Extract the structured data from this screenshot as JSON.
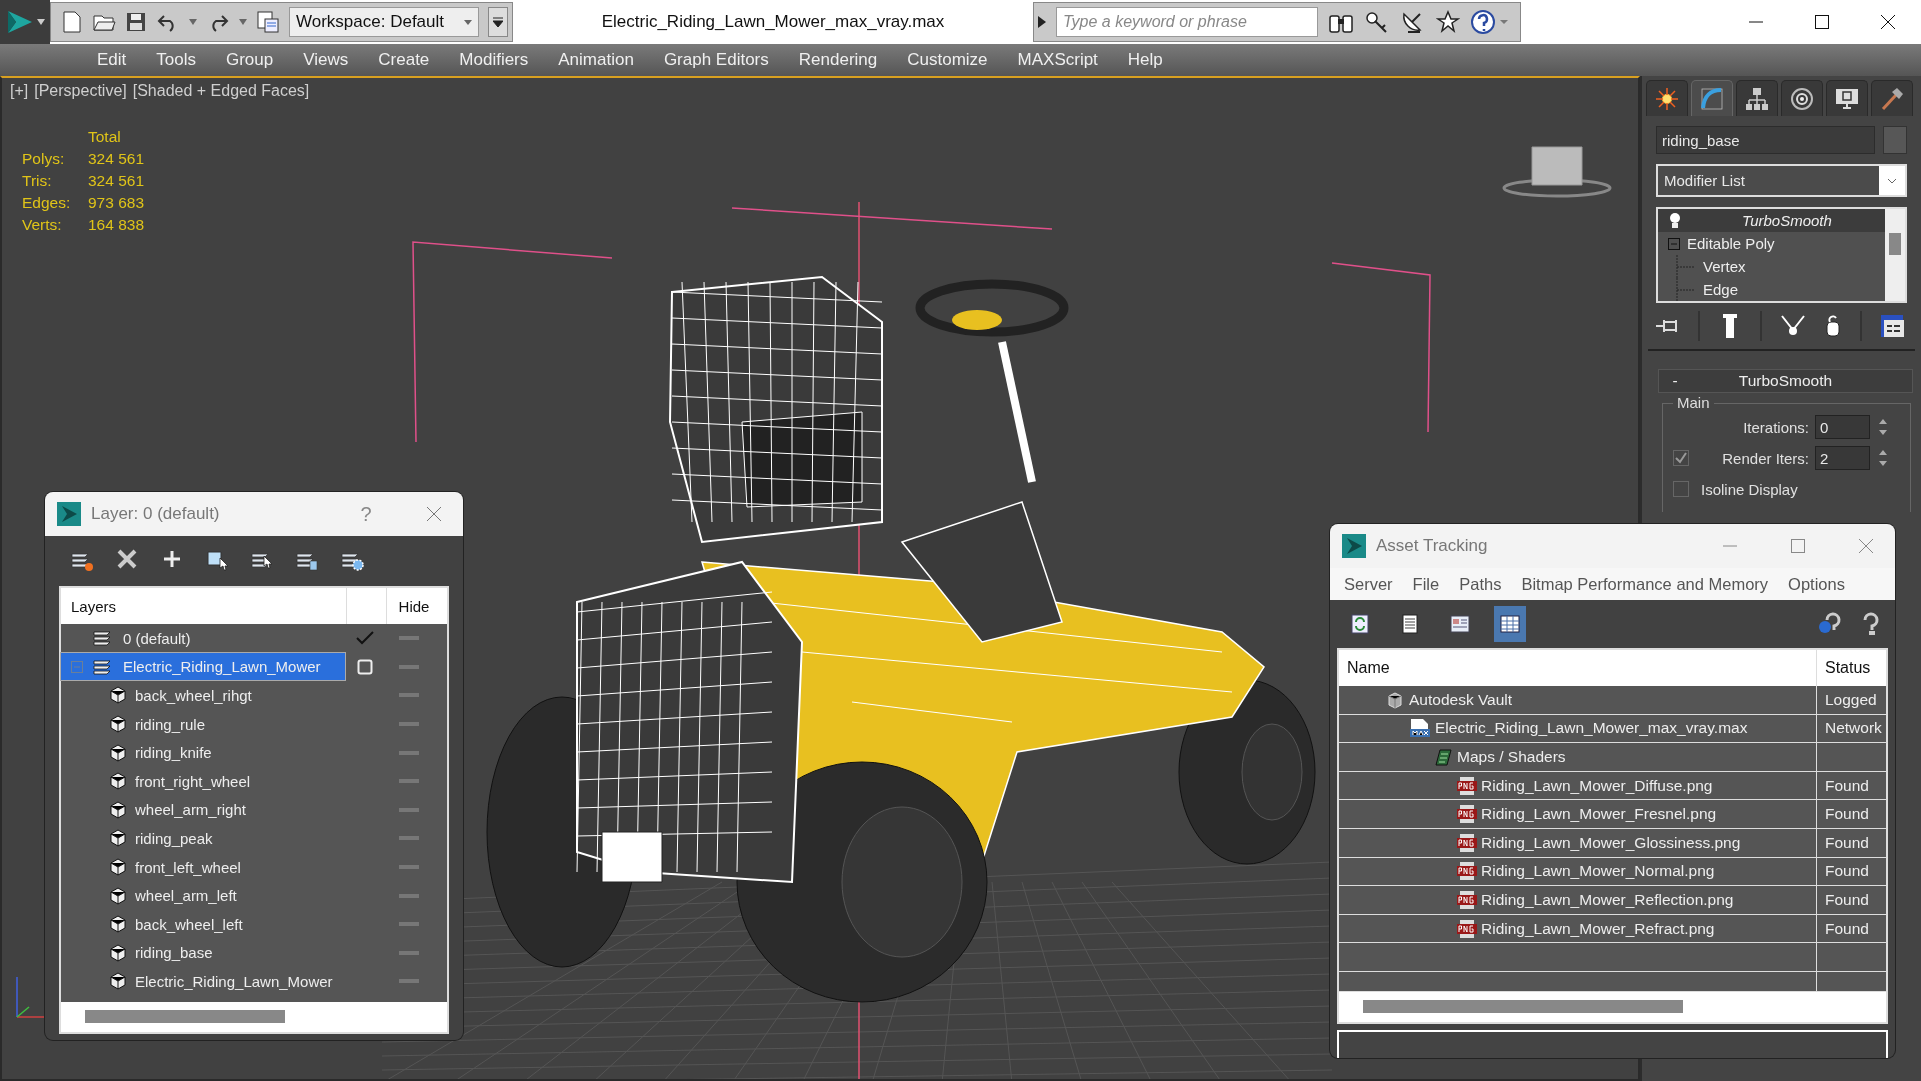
{
  "app_bar": {
    "workspace": "Workspace: Default",
    "title": "Electric_Riding_Lawn_Mower_max_vray.max",
    "search": {
      "placeholder": "Type a keyword or phrase"
    }
  },
  "menu": [
    "Edit",
    "Tools",
    "Group",
    "Views",
    "Create",
    "Modifiers",
    "Animation",
    "Graph Editors",
    "Rendering",
    "Customize",
    "MAXScript",
    "Help"
  ],
  "viewport": {
    "labels": [
      "[+]",
      "[Perspective]",
      "[Shaded + Edged Faces]"
    ],
    "stats_header": "Total",
    "stats": [
      {
        "label": "Polys:",
        "value": "324 561"
      },
      {
        "label": "Tris:",
        "value": "324 561"
      },
      {
        "label": "Edges:",
        "value": "973 683"
      },
      {
        "label": "Verts:",
        "value": "164 838"
      }
    ]
  },
  "command_panel": {
    "tabs": [
      {
        "kind": "create",
        "selected": false
      },
      {
        "kind": "modify",
        "selected": true
      },
      {
        "kind": "hierarchy",
        "selected": false
      },
      {
        "kind": "motion",
        "selected": false
      },
      {
        "kind": "display",
        "selected": false
      },
      {
        "kind": "utilities",
        "selected": false
      }
    ],
    "object_name": "riding_base",
    "modifier_list": "Modifier List",
    "stack": [
      {
        "label": "TurboSmooth",
        "kind": "modifier",
        "selected": true
      },
      {
        "label": "Editable Poly",
        "kind": "object",
        "selected": false,
        "expanded": true
      },
      {
        "label": "Vertex",
        "kind": "sub",
        "selected": false
      },
      {
        "label": "Edge",
        "kind": "sub",
        "selected": false
      }
    ],
    "rollout": {
      "title": "TurboSmooth",
      "collapse": "-",
      "group": "Main",
      "params": [
        {
          "kind": "spinner",
          "label": "Iterations:",
          "value": "0"
        },
        {
          "kind": "check-spinner",
          "label": "Render Iters:",
          "value": "2",
          "checked": true
        },
        {
          "kind": "checkbox",
          "label": "Isoline Display",
          "checked": false
        }
      ]
    }
  },
  "layer_dialog": {
    "title": "Layer: 0 (default)",
    "help": "?",
    "toolbar": [
      {
        "kind": "create"
      },
      {
        "kind": "delete"
      },
      {
        "kind": "add"
      },
      {
        "kind": "select-objects"
      },
      {
        "kind": "select-layer"
      },
      {
        "kind": "current"
      },
      {
        "kind": "options"
      }
    ],
    "columns": [
      "Layers",
      "Hide"
    ],
    "layers": [
      {
        "name": "0 (default)",
        "current": true,
        "selected": false
      },
      {
        "name": "Electric_Riding_Lawn_Mower",
        "current": false,
        "selected": true,
        "expanded": true,
        "children": [
          {
            "name": "back_wheel_rihgt",
            "selected": false
          },
          {
            "name": "riding_rule",
            "selected": false
          },
          {
            "name": "riding_knife",
            "selected": false
          },
          {
            "name": "front_right_wheel",
            "selected": false
          },
          {
            "name": "wheel_arm_right",
            "selected": false
          },
          {
            "name": "riding_peak",
            "selected": false
          },
          {
            "name": "front_left_wheel",
            "selected": false
          },
          {
            "name": "wheel_arm_left",
            "selected": false
          },
          {
            "name": "back_wheel_left",
            "selected": false
          },
          {
            "name": "riding_base",
            "selected": false
          },
          {
            "name": "Electric_Riding_Lawn_Mower",
            "selected": false
          }
        ]
      }
    ]
  },
  "asset_tracking": {
    "title": "Asset Tracking",
    "menu": [
      "Server",
      "File",
      "Paths",
      "Bitmap Performance and Memory",
      "Options"
    ],
    "toolbar": [
      {
        "kind": "refresh",
        "selected": false
      },
      {
        "kind": "list",
        "selected": false
      },
      {
        "kind": "thumbnails",
        "selected": false
      },
      {
        "kind": "table",
        "selected": true
      }
    ],
    "columns": [
      "Name",
      "Status"
    ],
    "rows": [
      {
        "name": "Autodesk Vault",
        "status": "Logged",
        "kind": "vault",
        "children": [
          {
            "name": "Electric_Riding_Lawn_Mower_max_vray.max",
            "status": "Network",
            "kind": "scene",
            "children": [
              {
                "name": "Maps / Shaders",
                "kind": "maps",
                "children": [
                  {
                    "name": "Riding_Lawn_Mower_Diffuse.png",
                    "status": "Found",
                    "kind": "png"
                  },
                  {
                    "name": "Riding_Lawn_Mower_Fresnel.png",
                    "status": "Found",
                    "kind": "png"
                  },
                  {
                    "name": "Riding_Lawn_Mower_Glossiness.png",
                    "status": "Found",
                    "kind": "png"
                  },
                  {
                    "name": "Riding_Lawn_Mower_Normal.png",
                    "status": "Found",
                    "kind": "png"
                  },
                  {
                    "name": "Riding_Lawn_Mower_Reflection.png",
                    "status": "Found",
                    "kind": "png"
                  },
                  {
                    "name": "Riding_Lawn_Mower_Refract.png",
                    "status": "Found",
                    "kind": "png"
                  }
                ]
              }
            ]
          }
        ]
      }
    ]
  }
}
